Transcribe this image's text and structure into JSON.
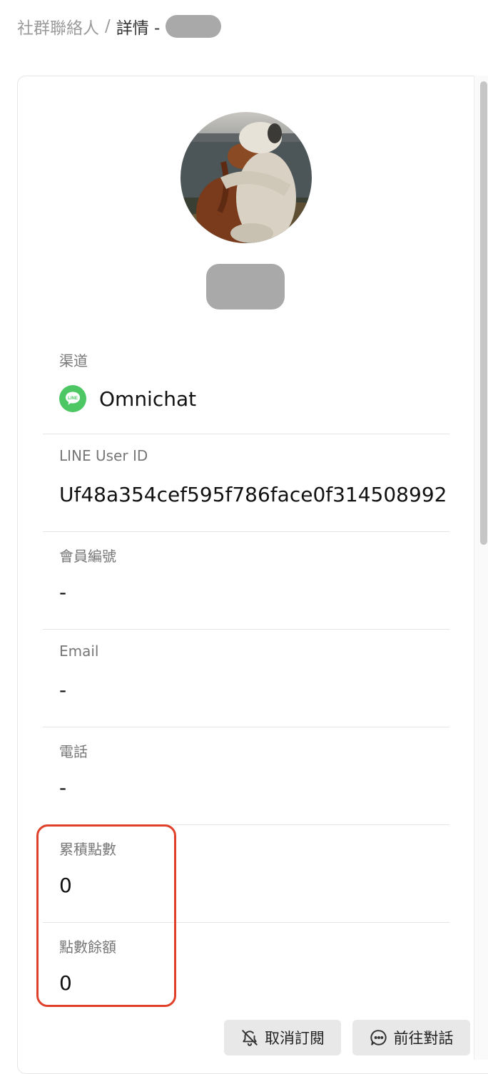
{
  "breadcrumb": {
    "parent": "社群聯絡人",
    "separator": "/",
    "current": "詳情 -"
  },
  "profile": {
    "avatar": "dog-photo-avatar"
  },
  "fields": [
    {
      "label": "渠道",
      "value": "Omnichat",
      "icon": "line-icon"
    },
    {
      "label": "LINE User ID",
      "value": "Uf48a354cef595f786face0f314508992"
    },
    {
      "label": "會員編號",
      "value": "-"
    },
    {
      "label": "Email",
      "value": "-"
    },
    {
      "label": "電話",
      "value": "-"
    },
    {
      "label": "累積點數",
      "value": "0"
    },
    {
      "label": "點數餘額",
      "value": "0"
    }
  ],
  "line_icon_text": "LINE",
  "actions": {
    "unsubscribe": {
      "label": "取消訂閱",
      "icon": "bell-off-icon"
    },
    "go_chat": {
      "label": "前往對話",
      "icon": "chat-bubble-icon"
    }
  },
  "colors": {
    "highlight": "#e0402a",
    "line_green": "#4cc764",
    "button_bg": "#e8e8e8"
  }
}
